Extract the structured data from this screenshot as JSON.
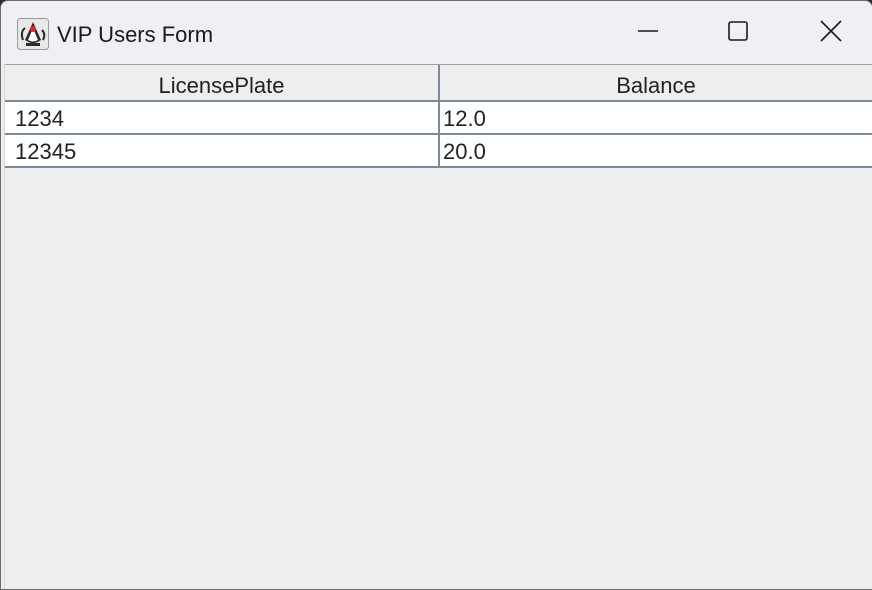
{
  "window": {
    "title": "VIP Users Form",
    "app_icon": "java-duke-icon",
    "controls": {
      "minimize": "minimize-icon",
      "maximize": "maximize-icon",
      "close": "close-icon"
    }
  },
  "table": {
    "columns": [
      "LicensePlate",
      "Balance"
    ],
    "rows": [
      [
        "1234",
        "12.0"
      ],
      [
        "12345",
        "20.0"
      ]
    ]
  },
  "colors": {
    "titlebar": "#f0eff6",
    "content_bg": "#eeeeee",
    "row_bg": "#ffffff",
    "grid_line": "#7a8a99"
  }
}
